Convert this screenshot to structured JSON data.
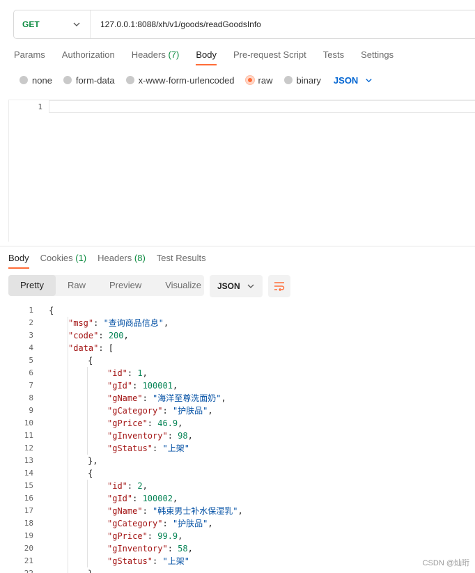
{
  "request": {
    "method": "GET",
    "url": "127.0.0.1:8088/xh/v1/goods/readGoodsInfo",
    "tabs": [
      {
        "label": "Params",
        "count": ""
      },
      {
        "label": "Authorization",
        "count": ""
      },
      {
        "label": "Headers",
        "count": "(7)"
      },
      {
        "label": "Body",
        "count": ""
      },
      {
        "label": "Pre-request Script",
        "count": ""
      },
      {
        "label": "Tests",
        "count": ""
      },
      {
        "label": "Settings",
        "count": ""
      }
    ],
    "active_tab": "Body",
    "body_types": [
      "none",
      "form-data",
      "x-www-form-urlencoded",
      "raw",
      "binary"
    ],
    "selected_body_type": "raw",
    "body_format": "JSON",
    "editor_line": "1"
  },
  "response": {
    "tabs": [
      {
        "label": "Body",
        "count": ""
      },
      {
        "label": "Cookies",
        "count": "(1)"
      },
      {
        "label": "Headers",
        "count": "(8)"
      },
      {
        "label": "Test Results",
        "count": ""
      }
    ],
    "active_tab": "Body",
    "views": [
      "Pretty",
      "Raw",
      "Preview",
      "Visualize"
    ],
    "active_view": "Pretty",
    "format": "JSON",
    "lines": [
      {
        "n": "1",
        "indent": 0,
        "parts": [
          [
            "p",
            "{"
          ]
        ]
      },
      {
        "n": "2",
        "indent": 1,
        "parts": [
          [
            "k",
            "\"msg\""
          ],
          [
            "p",
            ": "
          ],
          [
            "s",
            "\"查询商品信息\""
          ],
          [
            "p",
            ","
          ]
        ]
      },
      {
        "n": "3",
        "indent": 1,
        "parts": [
          [
            "k",
            "\"code\""
          ],
          [
            "p",
            ": "
          ],
          [
            "n",
            "200"
          ],
          [
            "p",
            ","
          ]
        ]
      },
      {
        "n": "4",
        "indent": 1,
        "parts": [
          [
            "k",
            "\"data\""
          ],
          [
            "p",
            ": ["
          ]
        ]
      },
      {
        "n": "5",
        "indent": 2,
        "parts": [
          [
            "p",
            "{"
          ]
        ]
      },
      {
        "n": "6",
        "indent": 3,
        "parts": [
          [
            "k",
            "\"id\""
          ],
          [
            "p",
            ": "
          ],
          [
            "n",
            "1"
          ],
          [
            "p",
            ","
          ]
        ]
      },
      {
        "n": "7",
        "indent": 3,
        "parts": [
          [
            "k",
            "\"gId\""
          ],
          [
            "p",
            ": "
          ],
          [
            "n",
            "100001"
          ],
          [
            "p",
            ","
          ]
        ]
      },
      {
        "n": "8",
        "indent": 3,
        "parts": [
          [
            "k",
            "\"gName\""
          ],
          [
            "p",
            ": "
          ],
          [
            "s",
            "\"海洋至尊洗面奶\""
          ],
          [
            "p",
            ","
          ]
        ]
      },
      {
        "n": "9",
        "indent": 3,
        "parts": [
          [
            "k",
            "\"gCategory\""
          ],
          [
            "p",
            ": "
          ],
          [
            "s",
            "\"护肤品\""
          ],
          [
            "p",
            ","
          ]
        ]
      },
      {
        "n": "10",
        "indent": 3,
        "parts": [
          [
            "k",
            "\"gPrice\""
          ],
          [
            "p",
            ": "
          ],
          [
            "n",
            "46.9"
          ],
          [
            "p",
            ","
          ]
        ]
      },
      {
        "n": "11",
        "indent": 3,
        "parts": [
          [
            "k",
            "\"gInventory\""
          ],
          [
            "p",
            ": "
          ],
          [
            "n",
            "98"
          ],
          [
            "p",
            ","
          ]
        ]
      },
      {
        "n": "12",
        "indent": 3,
        "parts": [
          [
            "k",
            "\"gStatus\""
          ],
          [
            "p",
            ": "
          ],
          [
            "s",
            "\"上架\""
          ]
        ]
      },
      {
        "n": "13",
        "indent": 2,
        "parts": [
          [
            "p",
            "},"
          ]
        ]
      },
      {
        "n": "14",
        "indent": 2,
        "parts": [
          [
            "p",
            "{"
          ]
        ]
      },
      {
        "n": "15",
        "indent": 3,
        "parts": [
          [
            "k",
            "\"id\""
          ],
          [
            "p",
            ": "
          ],
          [
            "n",
            "2"
          ],
          [
            "p",
            ","
          ]
        ]
      },
      {
        "n": "16",
        "indent": 3,
        "parts": [
          [
            "k",
            "\"gId\""
          ],
          [
            "p",
            ": "
          ],
          [
            "n",
            "100002"
          ],
          [
            "p",
            ","
          ]
        ]
      },
      {
        "n": "17",
        "indent": 3,
        "parts": [
          [
            "k",
            "\"gName\""
          ],
          [
            "p",
            ": "
          ],
          [
            "s",
            "\"韩束男士补水保湿乳\""
          ],
          [
            "p",
            ","
          ]
        ]
      },
      {
        "n": "18",
        "indent": 3,
        "parts": [
          [
            "k",
            "\"gCategory\""
          ],
          [
            "p",
            ": "
          ],
          [
            "s",
            "\"护肤品\""
          ],
          [
            "p",
            ","
          ]
        ]
      },
      {
        "n": "19",
        "indent": 3,
        "parts": [
          [
            "k",
            "\"gPrice\""
          ],
          [
            "p",
            ": "
          ],
          [
            "n",
            "99.9"
          ],
          [
            "p",
            ","
          ]
        ]
      },
      {
        "n": "20",
        "indent": 3,
        "parts": [
          [
            "k",
            "\"gInventory\""
          ],
          [
            "p",
            ": "
          ],
          [
            "n",
            "58"
          ],
          [
            "p",
            ","
          ]
        ]
      },
      {
        "n": "21",
        "indent": 3,
        "parts": [
          [
            "k",
            "\"gStatus\""
          ],
          [
            "p",
            ": "
          ],
          [
            "s",
            "\"上架\""
          ]
        ]
      },
      {
        "n": "22",
        "indent": 2,
        "parts": [
          [
            "p",
            "}"
          ]
        ]
      }
    ]
  },
  "watermark": "CSDN @灿珩",
  "colors": {
    "accent": "#ff6c37",
    "method": "#0b8a3f",
    "json_select": "#0265d2",
    "key": "#a31515",
    "string": "#0451a5",
    "number": "#098658"
  }
}
